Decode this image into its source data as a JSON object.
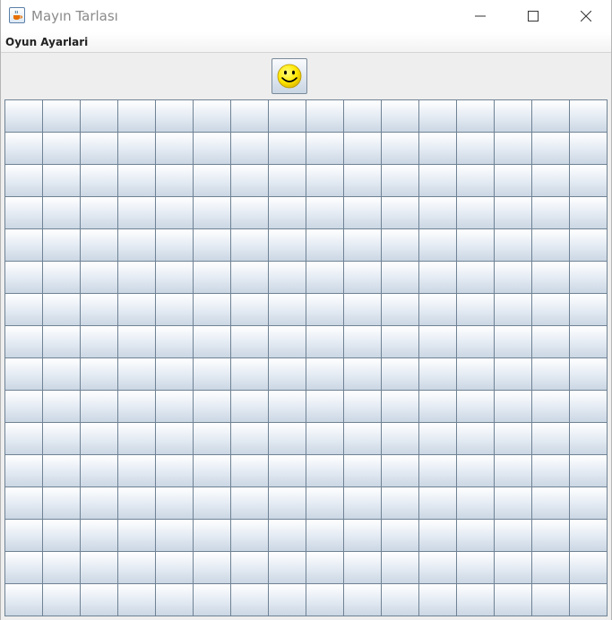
{
  "window": {
    "title": "Mayın Tarlası",
    "app_icon": "java-cup-icon",
    "controls": [
      "minimize-icon",
      "maximize-icon",
      "close-icon"
    ]
  },
  "menubar": {
    "items": [
      {
        "label": "Oyun Ayarlari"
      }
    ]
  },
  "toolbar": {
    "reset_button_icon": "smiley-face-icon"
  },
  "board": {
    "rows": 16,
    "columns": 16,
    "state": "all-covered"
  },
  "colors": {
    "cell_border": "#6f8294",
    "cell_top": "#ffffff",
    "cell_bottom": "#cbd7e4",
    "smiley_face": "#ffe600"
  }
}
